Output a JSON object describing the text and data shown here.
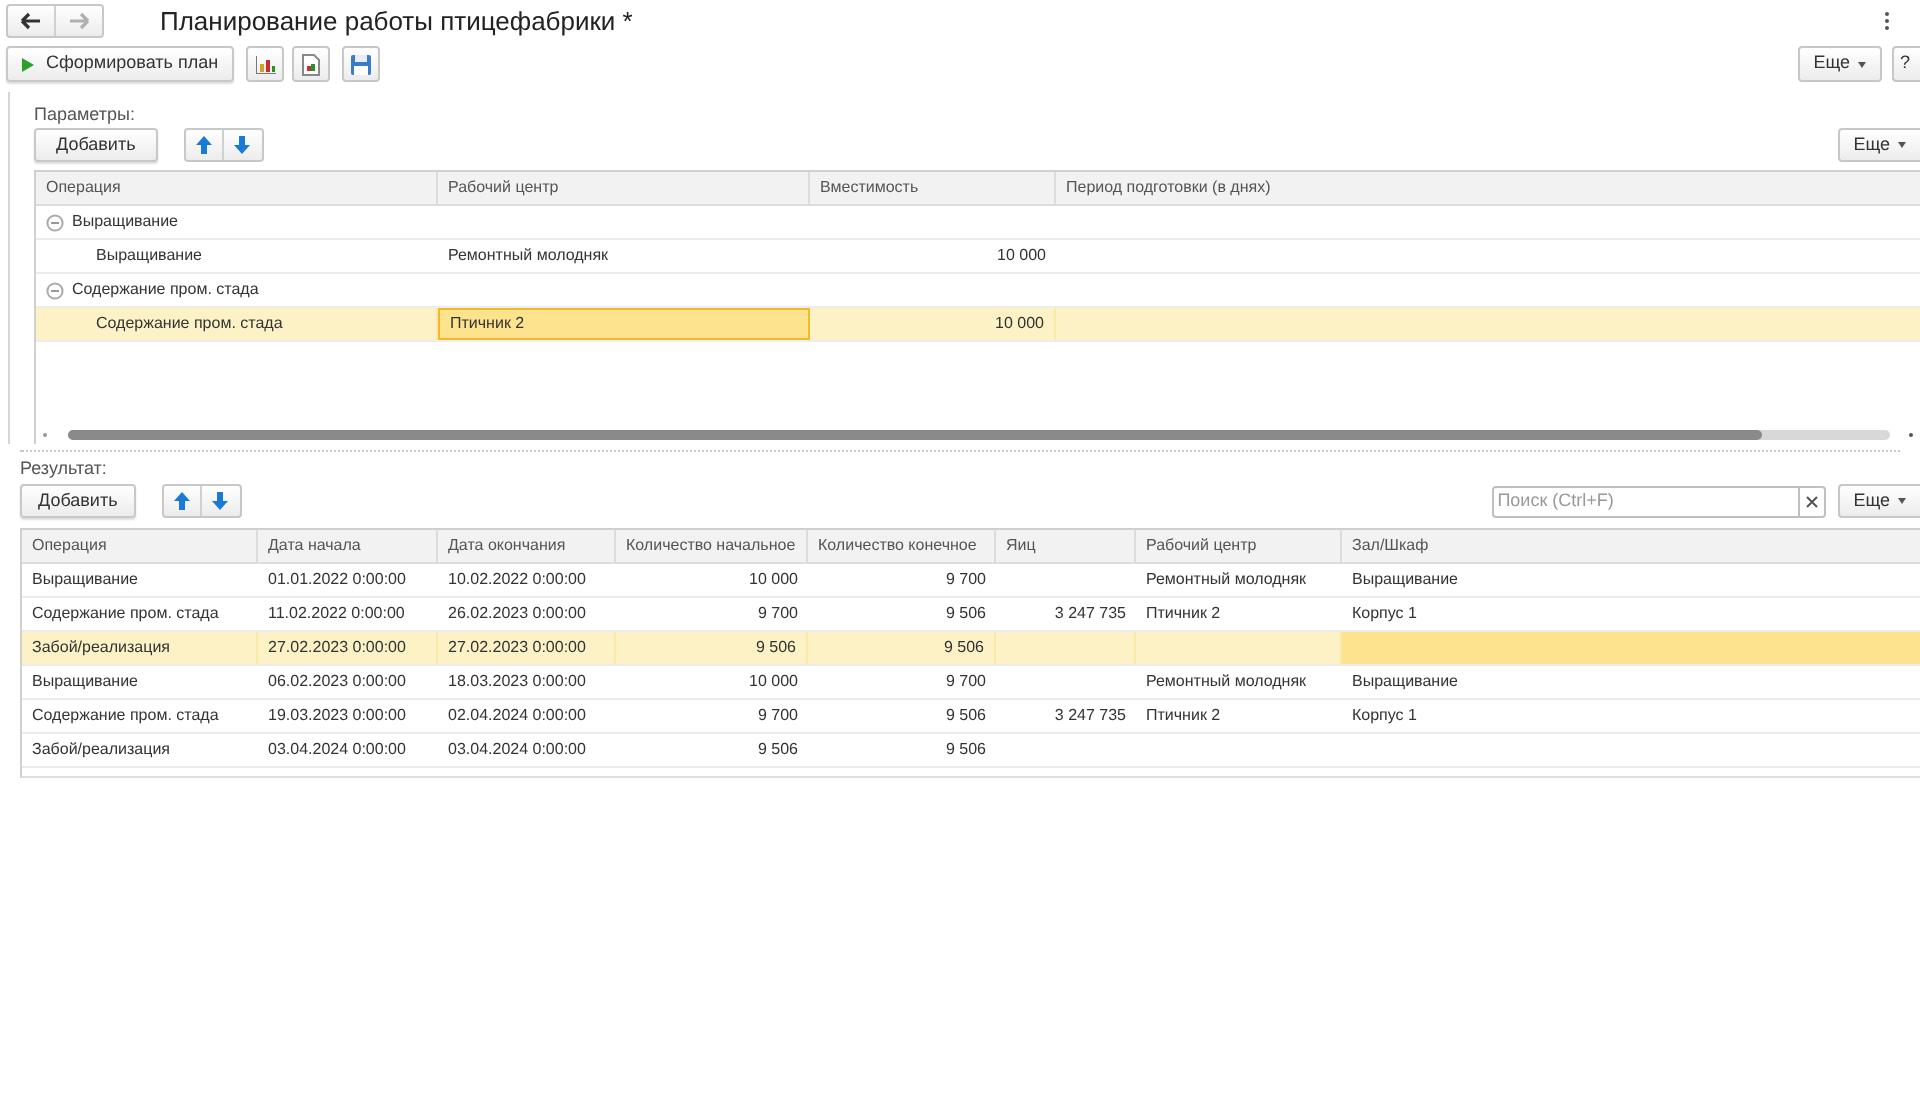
{
  "window": {
    "title": "Планирование работы птицефабрики *",
    "back_enabled": true,
    "forward_enabled": false
  },
  "toolbar": {
    "run_button": "Сформировать план",
    "more_button": "Еще",
    "help_button": "?"
  },
  "parameters": {
    "label": "Параметры:",
    "add_button": "Добавить",
    "more_button": "Еще",
    "columns": [
      "Операция",
      "Рабочий центр",
      "Вместимость",
      "Период подготовки (в днях)"
    ],
    "groups": [
      {
        "label": "Выращивание",
        "expanded": true,
        "children": [
          {
            "operation": "Выращивание",
            "work_center": "Ремонтный молодняк",
            "capacity": "10 000",
            "selected": false
          }
        ]
      },
      {
        "label": "Содержание пром. стада",
        "expanded": true,
        "children": [
          {
            "operation": "Содержание пром. стада",
            "work_center": {
              "text": "Птичник 2",
              "focused": true
            },
            "capacity": "10 000",
            "selected": true
          }
        ]
      }
    ]
  },
  "result": {
    "label": "Результат:",
    "add_button": "Добавить",
    "search": {
      "placeholder": "Поиск (Ctrl+F)"
    },
    "more_button": "Еще",
    "columns": [
      "Операция",
      "Дата начала",
      "Дата окончания",
      "Количество начальное",
      "Количество конечное",
      "Яиц",
      "Рабочий центр",
      "Зал/Шкаф"
    ],
    "rows": [
      {
        "operation": "Выращивание",
        "start": "01.01.2022 0:00:00",
        "end": "10.02.2022 0:00:00",
        "qty_start": "10 000",
        "qty_end": "9 700",
        "work_center": "Ремонтный молодняк",
        "hall": "Выращивание",
        "selected": false
      },
      {
        "operation": "Содержание пром. стада",
        "start": "11.02.2022 0:00:00",
        "end": "26.02.2023 0:00:00",
        "qty_start": "9 700",
        "qty_end": "9 506",
        "eggs": "3 247 735",
        "work_center": "Птичник 2",
        "hall": "Корпус 1",
        "selected": false
      },
      {
        "operation": "Забой/реализация",
        "start": "27.02.2023 0:00:00",
        "end": "27.02.2023 0:00:00",
        "qty_start": "9 506",
        "qty_end": "9 506",
        "hall": {
          "focused": true
        },
        "selected": true
      },
      {
        "operation": "Выращивание",
        "start": "06.02.2023 0:00:00",
        "end": "18.03.2023 0:00:00",
        "qty_start": "10 000",
        "qty_end": "9 700",
        "work_center": "Ремонтный молодняк",
        "hall": "Выращивание",
        "selected": false
      },
      {
        "operation": "Содержание пром. стада",
        "start": "19.03.2023 0:00:00",
        "end": "02.04.2024 0:00:00",
        "qty_start": "9 700",
        "qty_end": "9 506",
        "eggs": "3 247 735",
        "work_center": "Птичник 2",
        "hall": "Корпус 1",
        "selected": false
      },
      {
        "operation": "Забой/реализация",
        "start": "03.04.2024 0:00:00",
        "end": "03.04.2024 0:00:00",
        "qty_start": "9 506",
        "qty_end": "9 506",
        "selected": false
      }
    ]
  }
}
